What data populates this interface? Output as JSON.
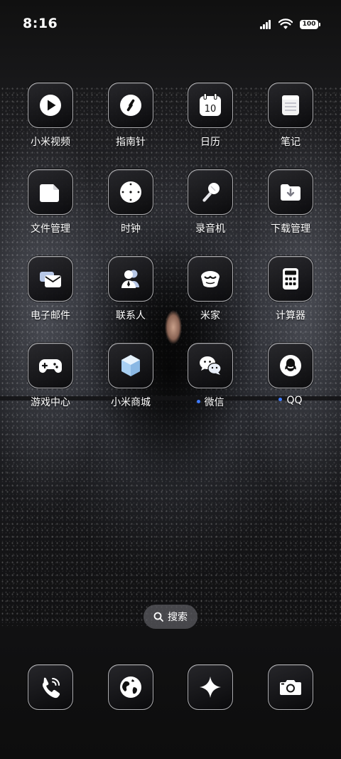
{
  "status_bar": {
    "time": "8:16",
    "battery": "100"
  },
  "apps": [
    {
      "label": "小米视频",
      "icon": "play-icon"
    },
    {
      "label": "指南针",
      "icon": "compass-icon"
    },
    {
      "label": "日历",
      "icon": "calendar-icon",
      "date": "10"
    },
    {
      "label": "笔记",
      "icon": "notes-icon"
    },
    {
      "label": "文件管理",
      "icon": "folder-icon"
    },
    {
      "label": "时钟",
      "icon": "clock-icon"
    },
    {
      "label": "录音机",
      "icon": "microphone-icon"
    },
    {
      "label": "下载管理",
      "icon": "download-icon"
    },
    {
      "label": "电子邮件",
      "icon": "mail-icon"
    },
    {
      "label": "联系人",
      "icon": "contacts-icon"
    },
    {
      "label": "米家",
      "icon": "mijia-icon"
    },
    {
      "label": "计算器",
      "icon": "calculator-icon"
    },
    {
      "label": "游戏中心",
      "icon": "gamepad-icon"
    },
    {
      "label": "小米商城",
      "icon": "cube-icon"
    },
    {
      "label": "微信",
      "icon": "wechat-icon",
      "new_dot": true
    },
    {
      "label": "QQ",
      "icon": "qq-icon",
      "new_dot": true
    }
  ],
  "search": {
    "label": "搜索"
  },
  "dock": [
    {
      "icon": "phone-icon"
    },
    {
      "icon": "globe-icon"
    },
    {
      "icon": "sparkle-icon"
    },
    {
      "icon": "camera-icon"
    }
  ],
  "colors": {
    "accent_dot": "#3f7bff",
    "tile_border": "#e1e1e6"
  }
}
